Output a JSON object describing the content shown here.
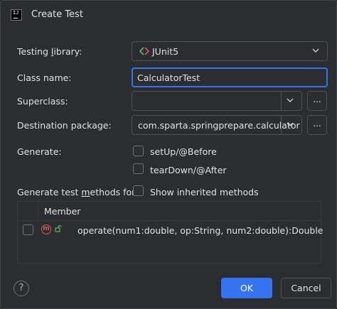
{
  "window": {
    "title": "Create Test",
    "app_icon_text": "IJ"
  },
  "form": {
    "testing_library": {
      "label_pre": "Testing ",
      "label_u": "l",
      "label_post": "ibrary:",
      "value": "JUnit5"
    },
    "class_name": {
      "label": "Class name:",
      "value": "CalculatorTest"
    },
    "superclass": {
      "label": "Superclass:",
      "value": "",
      "browse_label": "..."
    },
    "destination_package": {
      "label": "Destination package:",
      "value": "com.sparta.springprepare.calculator",
      "browse_label": "..."
    },
    "generate": {
      "label": "Generate:",
      "options": [
        {
          "label": "setUp/@Before",
          "checked": false
        },
        {
          "label": "tearDown/@After",
          "checked": false
        }
      ]
    },
    "test_methods": {
      "label_pre": "Generate test ",
      "label_u": "m",
      "label_post": "ethods for:",
      "show_inherited": {
        "label": "Show inherited methods",
        "checked": false
      }
    }
  },
  "table": {
    "column": "Member",
    "rows": [
      {
        "signature": "operate(num1:double, op:String, num2:double):Double",
        "checked": false,
        "icon": "method-icon"
      }
    ]
  },
  "footer": {
    "help": "?",
    "ok": "OK",
    "cancel": "Cancel"
  },
  "colors": {
    "accent": "#3574f0",
    "background": "#2b2d30",
    "method_icon": "#db5c5c"
  }
}
